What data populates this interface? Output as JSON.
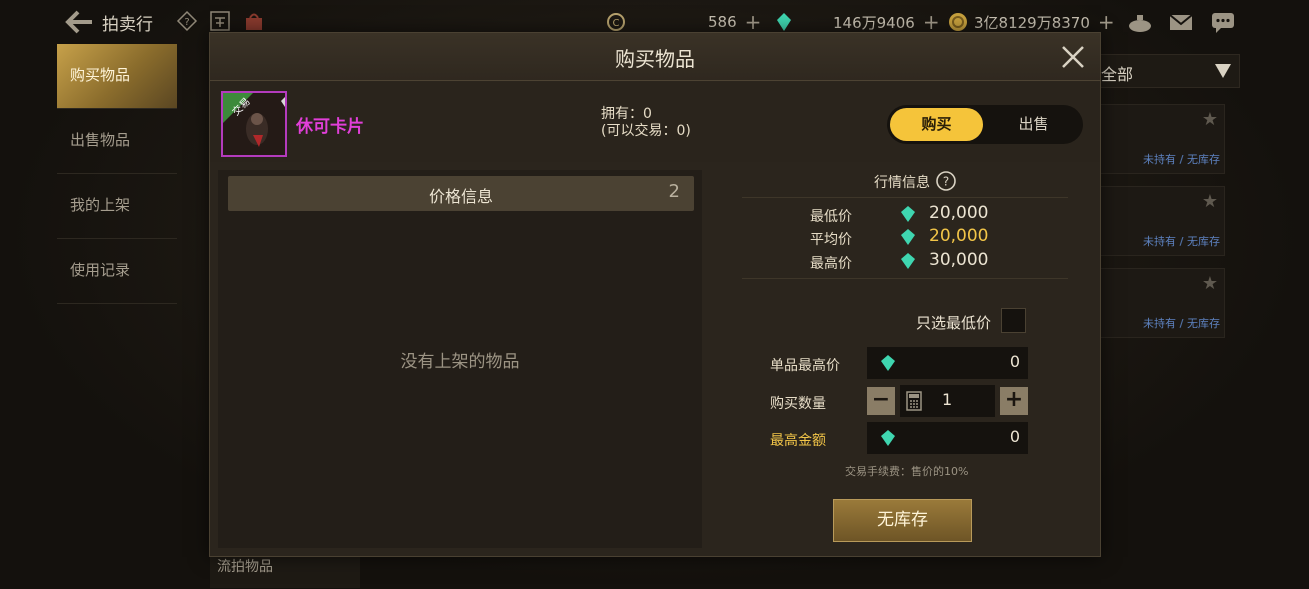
{
  "topbar": {
    "title": "拍卖行",
    "resources": [
      {
        "name": "coin",
        "icon": "c-coin-icon",
        "value": "586"
      },
      {
        "name": "gem",
        "icon": "gem-icon",
        "value": "146万9406"
      },
      {
        "name": "gold",
        "icon": "gold-coin-icon",
        "value": "3亿8129万8370"
      }
    ]
  },
  "sidebar": {
    "items": [
      {
        "label": "购买物品",
        "active": true
      },
      {
        "label": "出售物品",
        "active": false
      },
      {
        "label": "我的上架",
        "active": false
      },
      {
        "label": "使用记录",
        "active": false
      }
    ],
    "bottom_item": "流拍物品"
  },
  "right_list": {
    "filter": "全部",
    "cards": [
      {
        "status_a": "未持有",
        "sep": "/",
        "status_b": "无库存"
      },
      {
        "status_a": "未持有",
        "sep": "/",
        "status_b": "无库存"
      },
      {
        "status_a": "未持有",
        "sep": "/",
        "status_b": "无库存"
      }
    ]
  },
  "modal": {
    "title": "购买物品",
    "item": {
      "name": "休可卡片",
      "tag": "交易",
      "owned": "拥有：0",
      "tradable": "(可以交易：0)"
    },
    "toggle": {
      "buy": "购买",
      "sell": "出售",
      "selected": "buy"
    },
    "price_panel": {
      "title": "价格信息",
      "count": "2",
      "empty_text": "没有上架的物品"
    },
    "market": {
      "title": "行情信息",
      "rows": [
        {
          "label": "最低价",
          "value": "20,000"
        },
        {
          "label": "平均价",
          "value": "20,000"
        },
        {
          "label": "最高价",
          "value": "30,000"
        }
      ]
    },
    "only_lowest": {
      "label": "只选最低价",
      "checked": false
    },
    "max_unit_price": {
      "label": "单品最高价",
      "value": "0"
    },
    "quantity": {
      "label": "购买数量",
      "value": "1",
      "minus": "−",
      "plus": "+"
    },
    "max_total": {
      "label": "最高金额",
      "value": "0"
    },
    "fee_note": "交易手续费：售价的10%",
    "action_button": "无库存"
  },
  "colors": {
    "accent_gold": "#f5c43a",
    "item_name_purple": "#e13fd9",
    "gem_teal": "#3fd6b0"
  }
}
